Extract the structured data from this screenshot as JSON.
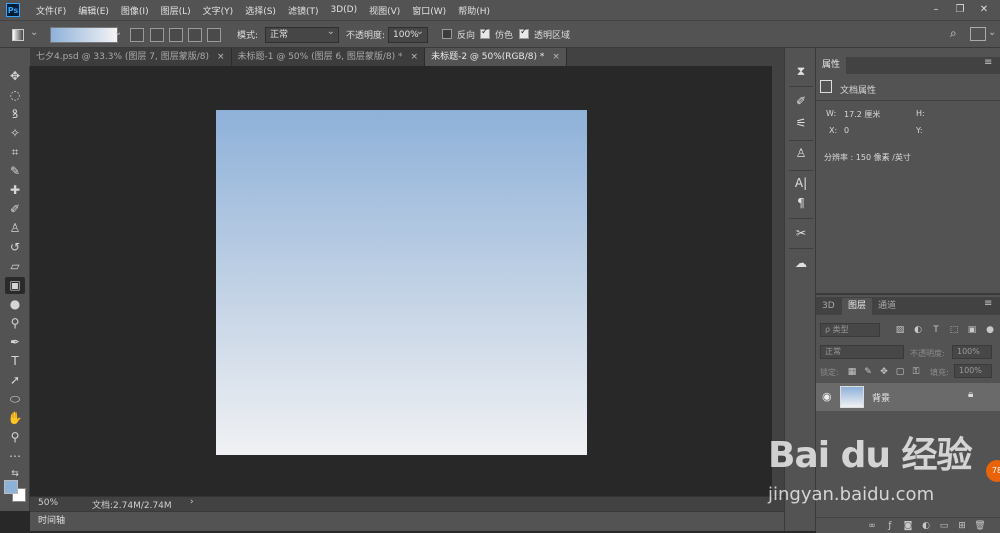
{
  "menubar": {
    "logo": "Ps",
    "items": [
      "文件(F)",
      "编辑(E)",
      "图像(I)",
      "图层(L)",
      "文字(Y)",
      "选择(S)",
      "滤镜(T)",
      "3D(D)",
      "视图(V)",
      "窗口(W)",
      "帮助(H)"
    ],
    "window_controls": [
      "–",
      "❐",
      "✕"
    ]
  },
  "options": {
    "mode_label": "模式:",
    "mode_value": "正常",
    "opacity_label": "不透明度:",
    "opacity_value": "100%",
    "reverse_label": "反向",
    "dither_label": "仿色",
    "transparency_label": "透明区域",
    "reverse_checked": false,
    "dither_checked": true,
    "transparency_checked": true
  },
  "tabs": [
    {
      "label": "七夕4.psd @ 33.3% (图层 7, 图层蒙版/8)",
      "close": "×",
      "active": false
    },
    {
      "label": "未标题-1 @ 50% (图层 6, 图层蒙版/8) *",
      "close": "×",
      "active": false
    },
    {
      "label": "未标题-2 @ 50%(RGB/8) *",
      "close": "×",
      "active": true
    }
  ],
  "status": {
    "zoom": "50%",
    "doc_info": "文档:2.74M/2.74M",
    "arrow": "›"
  },
  "timeline": {
    "label": "时间轴"
  },
  "properties": {
    "tab": "属性",
    "title": "文档属性",
    "w_label": "W:",
    "w_value": "17.2 厘米",
    "h_label": "H:",
    "x_label": "X:",
    "x_value": "0",
    "y_label": "Y:",
    "resolution": "分辨率 : 150 像素 /英寸"
  },
  "layers": {
    "tabs": [
      "3D",
      "图层",
      "通道"
    ],
    "filter_label": "ρ 类型",
    "blend_mode": "正常",
    "opacity_label": "不透明度:",
    "opacity_value": "100%",
    "lock_label": "锁定:",
    "fill_label": "填充:",
    "fill_value": "100%",
    "layer_name": "背景"
  },
  "watermark": {
    "brand": "Bai du 经验",
    "url": "jingyan.baidu.com"
  },
  "badge": "78"
}
